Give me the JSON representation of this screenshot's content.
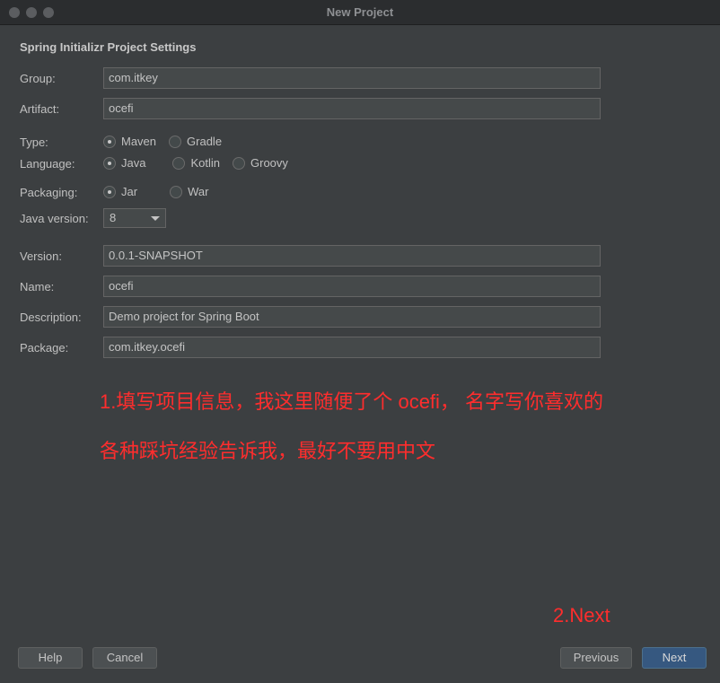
{
  "window": {
    "title": "New Project"
  },
  "section_title": "Spring Initializr Project Settings",
  "fields": {
    "group": {
      "label": "Group:",
      "value": "com.itkey"
    },
    "artifact": {
      "label": "Artifact:",
      "value": "ocefi"
    },
    "version": {
      "label": "Version:",
      "value": "0.0.1-SNAPSHOT"
    },
    "name": {
      "label": "Name:",
      "value": "ocefi"
    },
    "description": {
      "label": "Description:",
      "value": "Demo project for Spring Boot"
    },
    "package": {
      "label": "Package:",
      "value": "com.itkey.ocefi"
    }
  },
  "type": {
    "label": "Type:",
    "options": [
      "Maven",
      "Gradle"
    ],
    "selected": "Maven"
  },
  "language": {
    "label": "Language:",
    "options": [
      "Java",
      "Kotlin",
      "Groovy"
    ],
    "selected": "Java"
  },
  "packaging": {
    "label": "Packaging:",
    "options": [
      "Jar",
      "War"
    ],
    "selected": "Jar"
  },
  "java_version": {
    "label": "Java version:",
    "value": "8"
  },
  "annotations": {
    "line1": "1.填写项目信息，我这里随便了个 ocefi， 名字写你喜欢的",
    "line2": "各种踩坑经验告诉我，最好不要用中文",
    "next_hint": "2.Next"
  },
  "buttons": {
    "help": "Help",
    "cancel": "Cancel",
    "previous": "Previous",
    "next": "Next"
  },
  "colors": {
    "annotation": "#ff2d2d",
    "primary_button": "#365880",
    "background": "#3c3f41"
  }
}
